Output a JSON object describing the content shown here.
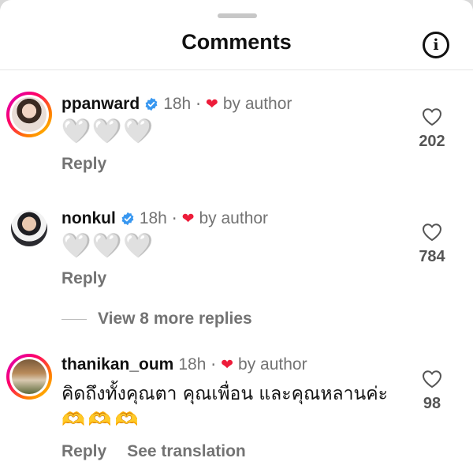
{
  "header": {
    "title": "Comments",
    "info_icon": "info-icon"
  },
  "comments": [
    {
      "username": "ppanward",
      "verified": true,
      "time": "18h",
      "liked_by_author": "by author",
      "text": "🤍🤍🤍",
      "reply_label": "Reply",
      "like_count": "202"
    },
    {
      "username": "nonkul",
      "verified": true,
      "time": "18h",
      "liked_by_author": "by author",
      "text": "🤍🤍🤍",
      "reply_label": "Reply",
      "like_count": "784"
    },
    {
      "username": "thanikan_oum",
      "verified": false,
      "time": "18h",
      "liked_by_author": "by author",
      "text": "คิดถึงทั้งคุณตา คุณเพื่อน และคุณหลานค่ะ",
      "text_line2": "🫶🫶🫶",
      "reply_label": "Reply",
      "see_translation_label": "See translation",
      "like_count": "98"
    }
  ],
  "view_more_replies": "View 8 more replies",
  "colors": {
    "author_heart": "#ed1c3a",
    "verified": "#3897f0",
    "muted": "#737373"
  }
}
